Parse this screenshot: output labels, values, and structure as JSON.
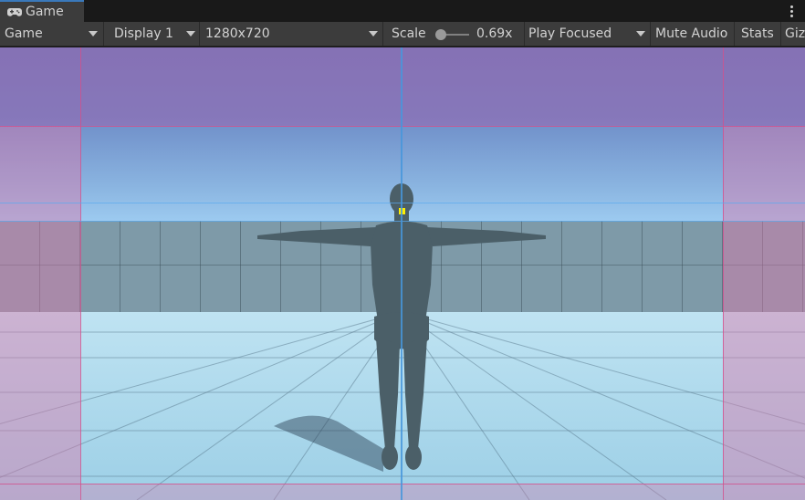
{
  "tab": {
    "label": "Game",
    "icon": "gamepad-icon"
  },
  "menu": {
    "icon": "more-vertical-icon"
  },
  "toolbar": {
    "view_dropdown": "Game",
    "display_dropdown": "Display 1",
    "resolution_dropdown": "1280x720",
    "scale_label": "Scale",
    "scale_value": "0.69x",
    "play_mode_dropdown": "Play Focused",
    "mute_audio": "Mute Audio",
    "stats": "Stats",
    "gizmos": "Gizmos"
  },
  "scene": {
    "description_colors": {
      "sky": "#6e8dc8",
      "wall": "#7e9aa8",
      "floor": "#bfe3f2",
      "character": "#4a5e66",
      "selection_marker": "#ffee00"
    }
  }
}
